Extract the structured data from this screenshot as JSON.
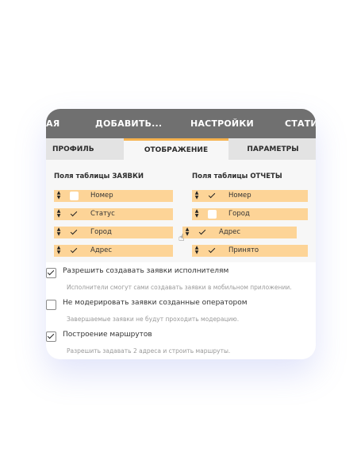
{
  "nav": {
    "items": [
      "АЯ",
      "ДОБАВИТЬ...",
      "НАСТРОЙКИ",
      "СТАТИ"
    ]
  },
  "tabs": {
    "profile": "ПРОФИЛЬ",
    "display": "ОТОБРАЖЕНИЕ",
    "params": "ПАРАМЕТРЫ",
    "active": "display"
  },
  "requests_table": {
    "title": "Поля таблицы ЗАЯВКИ",
    "fields": [
      {
        "label": "Номер",
        "checked": false
      },
      {
        "label": "Статус",
        "checked": true
      },
      {
        "label": "Город",
        "checked": true
      },
      {
        "label": "Адрес",
        "checked": true
      }
    ]
  },
  "reports_table": {
    "title": "Поля таблицы ОТЧЕТЫ",
    "fields": [
      {
        "label": "Номер",
        "checked": true
      },
      {
        "label": "Город",
        "checked": false
      },
      {
        "label": "Адрес",
        "checked": true
      },
      {
        "label": "Принято",
        "checked": true
      }
    ]
  },
  "options": [
    {
      "label": "Разрешить создавать заявки исполнителям",
      "desc": "Исполнители смогут сами создавать заявки в мобильном приложении.",
      "checked": true
    },
    {
      "label": "Не модерировать заявки созданные оператором",
      "desc": "Завершаемые заявки не будут проходить модерацию.",
      "checked": false
    },
    {
      "label": "Построение маршрутов",
      "desc": "Разрешить задавать 2 адреса и строить маршруты.",
      "checked": true
    }
  ],
  "colors": {
    "nav_bg": "#707070",
    "accent": "#f6b24e",
    "row_bg": "#fdd497"
  }
}
